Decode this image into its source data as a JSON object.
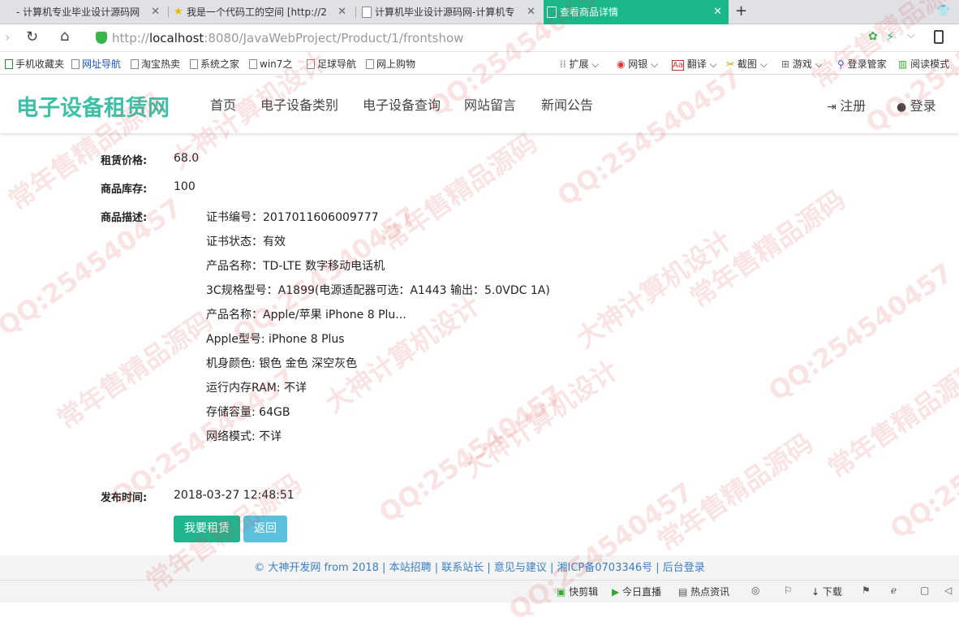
{
  "browser": {
    "tabs": [
      {
        "label": "- 计算机专业毕业设计源码网"
      },
      {
        "label": "我是一个代码工的空间 [http://2"
      },
      {
        "label": "计算机毕业设计源码网-计算机专"
      },
      {
        "label": "查看商品详情"
      }
    ],
    "new_tab": "+",
    "url_prefix": "http://",
    "url_host": "localhost",
    "url_rest": ":8080/JavaWebProject/Product/1/frontshow",
    "bookmarks": [
      "手机收藏夹",
      "网址导航",
      "淘宝热卖",
      "系统之家",
      "win7之",
      "足球导航",
      "网上购物"
    ],
    "tools": [
      "扩展",
      "网银",
      "翻译",
      "截图",
      "游戏",
      "登录管家",
      "阅读模式"
    ]
  },
  "site": {
    "logo": "电子设备租赁网",
    "nav": [
      "首页",
      "电子设备类别",
      "电子设备查询",
      "网站留言",
      "新闻公告"
    ],
    "register": "注册",
    "login": "登录"
  },
  "product": {
    "price_label": "租赁价格:",
    "price": "68.0",
    "stock_label": "商品库存:",
    "stock": "100",
    "desc_label": "商品描述:",
    "desc_lines": [
      "证书编号：2017011606009777",
      "证书状态：有效",
      "产品名称：TD-LTE 数字移动电话机",
      "3C规格型号：A1899(电源适配器可选：A1443 输出：5.0VDC 1A)",
      "产品名称：Apple/苹果 iPhone 8 Plu...",
      "Apple型号: iPhone 8 Plus",
      "机身颜色: 银色 金色 深空灰色",
      "运行内存RAM: 不详",
      "存储容量: 64GB",
      "网络模式: 不详"
    ],
    "time_label": "发布时间:",
    "time": "2018-03-27 12:48:51",
    "rent_button": "我要租赁",
    "back_button": "返回"
  },
  "footer": {
    "text": "© 大神开发网 from 2018 | 本站招聘 | 联系站长 | 意见与建议 | 湘ICP备0703346号 | 后台登录"
  },
  "statusbar": [
    "快剪辑",
    "今日直播",
    "热点资讯",
    "下载"
  ],
  "watermark": {
    "lines": [
      "QQ:254540457",
      "常年售精品源码",
      "大神计算机设计"
    ]
  },
  "colors": {
    "accent": "#19b789",
    "logo": "#3fc0a6",
    "rent_button": "#1fb58f",
    "back_button": "#5bc0de"
  }
}
